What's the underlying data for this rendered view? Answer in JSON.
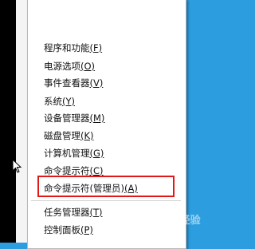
{
  "context_menu": {
    "items": [
      {
        "label": "程序和功能",
        "key": "(F)"
      },
      {
        "label": "电源选项",
        "key": "(O)"
      },
      {
        "label": "事件查看器",
        "key": "(V)"
      },
      {
        "label": "系统",
        "key": "(Y)"
      },
      {
        "label": "设备管理器",
        "key": "(M)"
      },
      {
        "label": "磁盘管理",
        "key": "(K)"
      },
      {
        "label": "计算机管理",
        "key": "(G)"
      },
      {
        "label": "命令提示符",
        "key": "(C)"
      },
      {
        "label": "命令提示符(管理员)",
        "key": "(A)"
      },
      {
        "label": "任务管理器",
        "key": "(T)"
      },
      {
        "label": "控制面板",
        "key": "(P)"
      }
    ]
  },
  "colors": {
    "desktop_background": "#2c9ee0",
    "highlight_border": "#e01818"
  },
  "watermark": {
    "text": "Bai 经验"
  }
}
